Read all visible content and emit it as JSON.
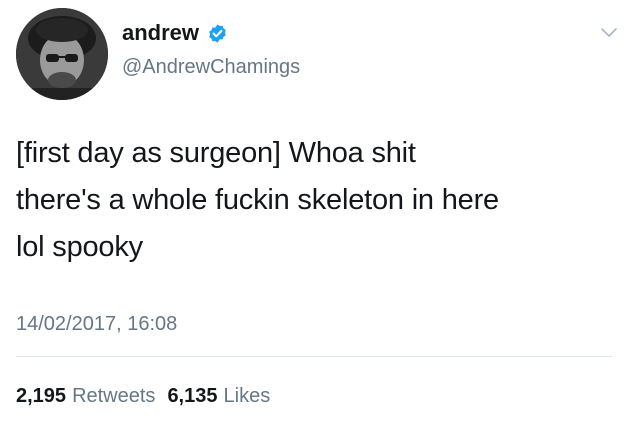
{
  "user": {
    "display_name": "andrew",
    "handle": "@AndrewChamings",
    "verified_icon": "verified-badge-icon",
    "avatar_icon": "user-avatar"
  },
  "tweet": {
    "lines": [
      "[first day as surgeon] Whoa shit",
      "there's a whole fuckin skeleton in here",
      "lol spooky"
    ],
    "timestamp": "14/02/2017, 16:08"
  },
  "stats": {
    "retweets_count": "2,195",
    "retweets_label": "Retweets",
    "likes_count": "6,135",
    "likes_label": "Likes"
  },
  "colors": {
    "text": "#14171a",
    "muted": "#657786",
    "verified_blue": "#1da1f2",
    "divider": "#e1e8ed"
  },
  "menu_icon": "chevron-down-icon"
}
